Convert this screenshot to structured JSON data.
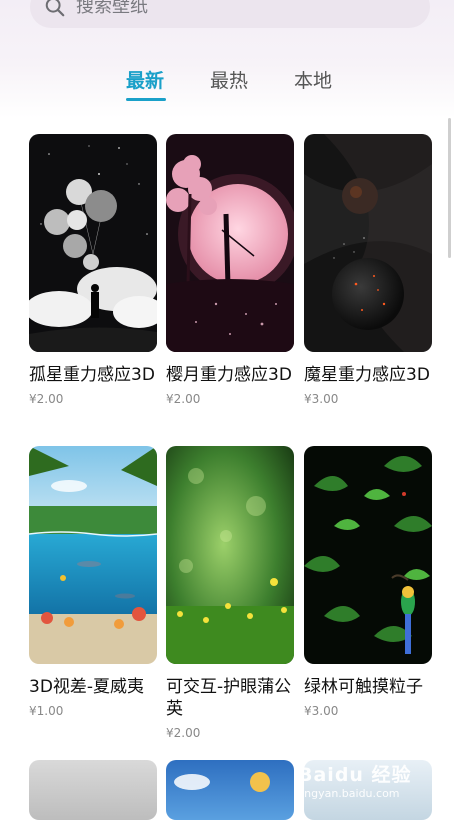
{
  "search": {
    "placeholder": "搜索壁纸"
  },
  "tabs": [
    {
      "label": "最新",
      "active": true
    },
    {
      "label": "最热",
      "active": false
    },
    {
      "label": "本地",
      "active": false
    }
  ],
  "colors": {
    "accent": "#1aa0c9"
  },
  "wallpapers": [
    {
      "title": "孤星重力感应3D",
      "price": "¥2.00"
    },
    {
      "title": "樱月重力感应3D",
      "price": "¥2.00"
    },
    {
      "title": "魔星重力感应3D",
      "price": "¥3.00"
    },
    {
      "title": "3D视差-夏威夷",
      "price": "¥1.00"
    },
    {
      "title": "可交互-护眼蒲公英",
      "price": "¥2.00"
    },
    {
      "title": "绿林可触摸粒子",
      "price": "¥3.00"
    }
  ],
  "watermark": {
    "brand": "Baidu 经验",
    "url": "jingyan.baidu.com"
  }
}
